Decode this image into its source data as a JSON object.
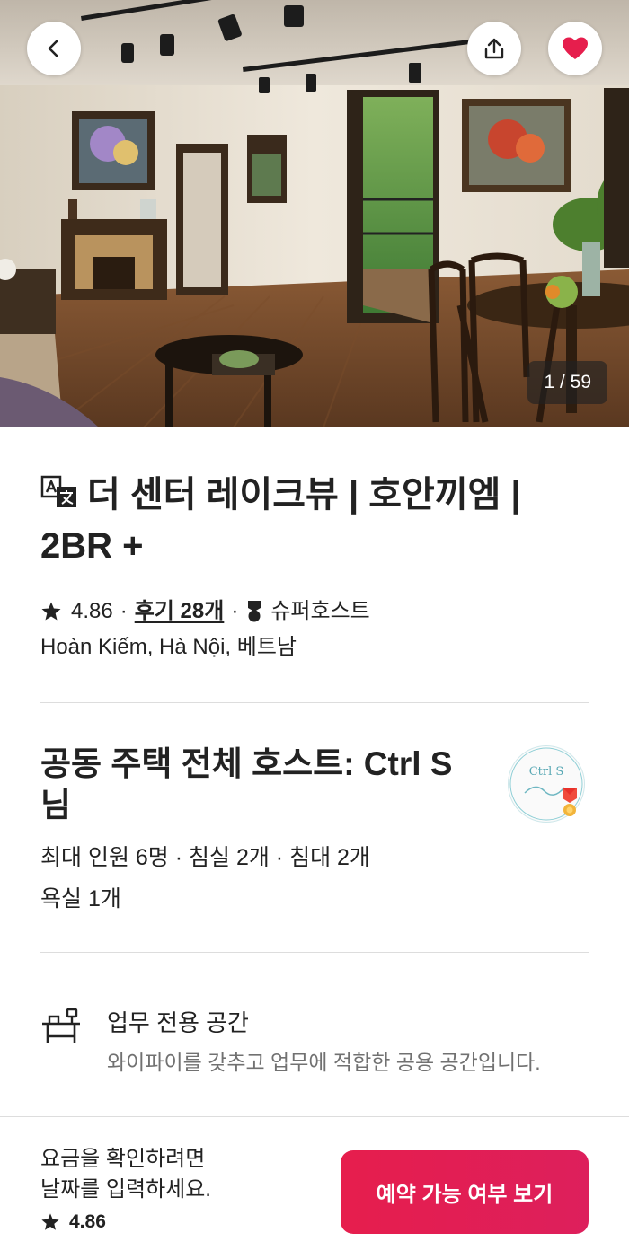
{
  "hero": {
    "photo_counter": "1 / 59",
    "back_icon": "chevron-left-icon",
    "share_icon": "share-icon",
    "wishlist_icon": "heart-icon",
    "accent_heart": "#e61e4d"
  },
  "listing": {
    "title": "더 센터 레이크뷰 | 호안끼엠 | 2BR +",
    "rating": "4.86",
    "reviews": "후기 28개",
    "superhost": "슈퍼호스트",
    "location": "Hoàn Kiếm, Hà Nội, 베트남"
  },
  "host": {
    "title": "공동 주택 전체 호스트: Ctrl S 님",
    "details_line1": "최대 인원 6명 · 침실 2개 · 침대 2개",
    "details_line2": "욕실 1개",
    "avatar_text": "Ctrl S"
  },
  "amenity": {
    "title": "업무 전용 공간",
    "description": "와이파이를 갖추고 업무에 적합한 공용 공간입니다."
  },
  "footer": {
    "price_note_line1": "요금을 확인하려면",
    "price_note_line2": "날짜를 입력하세요.",
    "rating": "4.86",
    "cta_label": "예약 가능 여부 보기",
    "cta_color": "#e61e4d"
  }
}
